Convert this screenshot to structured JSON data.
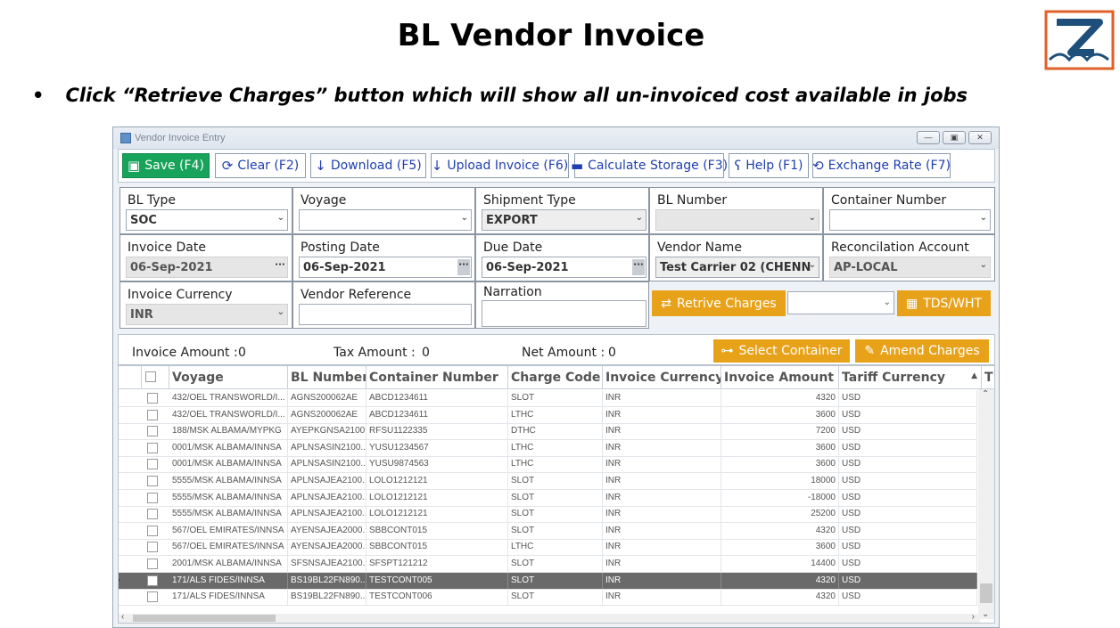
{
  "slide": {
    "title": "BL Vendor Invoice",
    "bullet": "•",
    "instruction": "Click “Retrieve Charges” button which will show all un-invoiced cost available in jobs"
  },
  "window": {
    "title": "Vendor Invoice Entry",
    "controls": {
      "minimize": "—",
      "restore": "▣",
      "close": "✕"
    }
  },
  "toolbar": {
    "save": "Save (F4)",
    "clear": "Clear (F2)",
    "download": "Download (F5)",
    "upload": "Upload Invoice (F6)",
    "calc_storage": "Calculate Storage (F3)",
    "help": "Help (F1)",
    "exchange": "Exchange Rate (F7)"
  },
  "form": {
    "bl_type": {
      "label": "BL Type",
      "value": "SOC"
    },
    "voyage": {
      "label": "Voyage",
      "value": ""
    },
    "shipment_type": {
      "label": "Shipment Type",
      "value": "EXPORT"
    },
    "bl_number": {
      "label": "BL Number",
      "value": ""
    },
    "container_number": {
      "label": "Container Number",
      "value": ""
    },
    "invoice_date": {
      "label": "Invoice Date",
      "value": "06-Sep-2021"
    },
    "posting_date": {
      "label": "Posting Date",
      "value": "06-Sep-2021"
    },
    "due_date": {
      "label": "Due Date",
      "value": "06-Sep-2021"
    },
    "vendor_name": {
      "label": "Vendor Name",
      "value": "Test Carrier 02 (CHENN"
    },
    "reconciliation_account": {
      "label": "Reconcilation Account",
      "value": "AP-LOCAL"
    },
    "invoice_currency": {
      "label": "Invoice Currency",
      "value": "INR"
    },
    "vendor_reference": {
      "label": "Vendor Reference",
      "value": ""
    },
    "narration": {
      "label": "Narration",
      "value": ""
    },
    "retrieve_charges": "Retrive Charges",
    "tds_wht": "TDS/WHT"
  },
  "summary": {
    "invoice_amount_label": "Invoice Amount :",
    "invoice_amount": "0",
    "tax_amount_label": "Tax Amount :",
    "tax_amount": "0",
    "net_amount_label": "Net Amount :",
    "net_amount": "0",
    "select_container": "Select Container",
    "amend_charges": "Amend Charges"
  },
  "grid": {
    "headers": [
      "Voyage",
      "BL Number",
      "Container Number",
      "Charge Code",
      "Invoice Currency",
      "Invoice Amount",
      "Tariff Currency",
      "T"
    ],
    "rows": [
      [
        "432/OEL TRANSWORLD/I...",
        "AGNS200062AE",
        "ABCD1234611",
        "SLOT",
        "INR",
        "4320",
        "USD"
      ],
      [
        "432/OEL TRANSWORLD/I...",
        "AGNS200062AE",
        "ABCD1234611",
        "LTHC",
        "INR",
        "3600",
        "USD"
      ],
      [
        "188/MSK ALBAMA/MYPKG",
        "AYEPKGNSA2100...",
        "RFSU1122335",
        "DTHC",
        "INR",
        "7200",
        "USD"
      ],
      [
        "0001/MSK ALBAMA/INNSA",
        "APLNSASIN2100...",
        "YUSU1234567",
        "LTHC",
        "INR",
        "3600",
        "USD"
      ],
      [
        "0001/MSK ALBAMA/INNSA",
        "APLNSASIN2100...",
        "YUSU9874563",
        "LTHC",
        "INR",
        "3600",
        "USD"
      ],
      [
        "5555/MSK ALBAMA/INNSA",
        "APLNSAJEA2100...",
        "LOLO1212121",
        "SLOT",
        "INR",
        "18000",
        "USD"
      ],
      [
        "5555/MSK ALBAMA/INNSA",
        "APLNSAJEA2100...",
        "LOLO1212121",
        "SLOT",
        "INR",
        "-18000",
        "USD"
      ],
      [
        "5555/MSK ALBAMA/INNSA",
        "APLNSAJEA2100...",
        "LOLO1212121",
        "SLOT",
        "INR",
        "25200",
        "USD"
      ],
      [
        "567/OEL EMIRATES/INNSA",
        "AYENSAJEA2000...",
        "SBBCONT015",
        "SLOT",
        "INR",
        "4320",
        "USD"
      ],
      [
        "567/OEL EMIRATES/INNSA",
        "AYENSAJEA2000...",
        "SBBCONT015",
        "LTHC",
        "INR",
        "3600",
        "USD"
      ],
      [
        "2001/MSK ALBAMA/INNSA",
        "SFSNSAJEA2100...",
        "SFSPT121212",
        "SLOT",
        "INR",
        "14400",
        "USD"
      ],
      [
        "171/ALS FIDES/INNSA",
        "BS19BL22FN890...",
        "TESTCONT005",
        "SLOT",
        "INR",
        "4320",
        "USD"
      ],
      [
        "171/ALS FIDES/INNSA",
        "BS19BL22FN890...",
        "TESTCONT006",
        "SLOT",
        "INR",
        "4320",
        "USD"
      ]
    ],
    "selected_row": 11
  },
  "colors": {
    "accent_orange": "#e8a21a",
    "save_green": "#17a35a",
    "link_blue": "#1f3fae",
    "selected_row": "#6a6a6a"
  }
}
